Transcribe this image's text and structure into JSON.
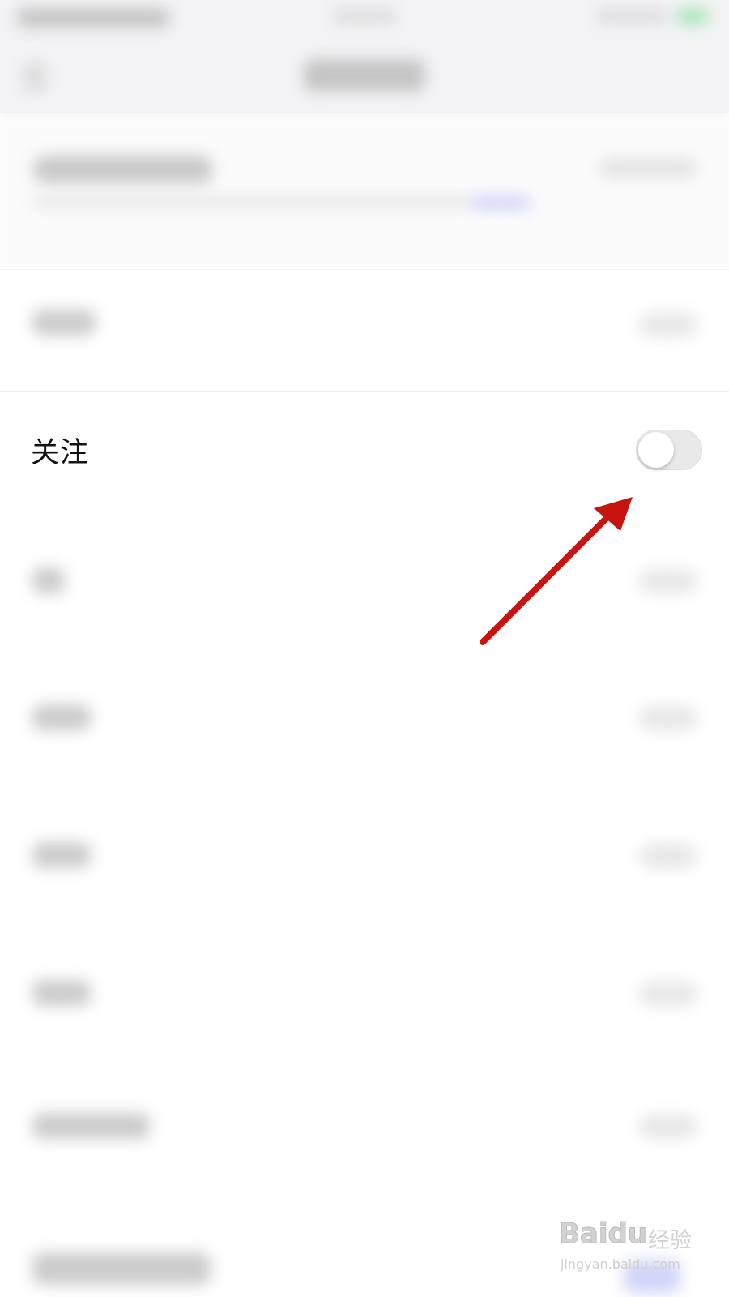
{
  "settings": {
    "rows": [
      {
        "label": "关注",
        "toggle_state": "off"
      }
    ]
  },
  "watermark": {
    "logo_text": "Baidu",
    "brand_text": "经验",
    "url_text": "jingyan.baidu.com"
  },
  "colors": {
    "annotation_arrow": "#c7140f",
    "toggle_off_track": "#e9e9ea",
    "background": "#ffffff"
  }
}
